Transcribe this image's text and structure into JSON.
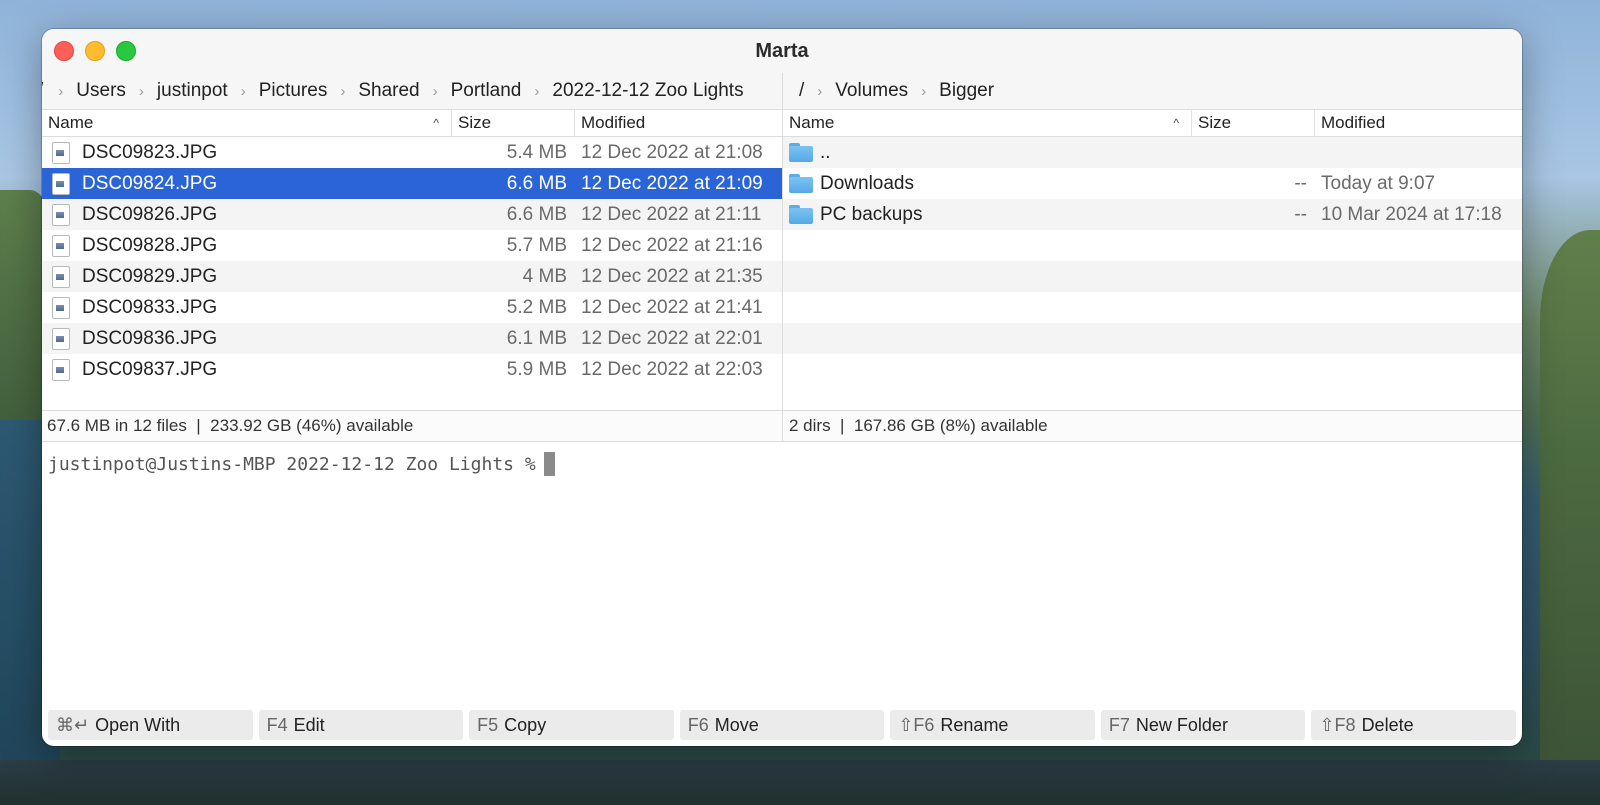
{
  "window": {
    "title": "Marta"
  },
  "left_pane": {
    "breadcrumb": [
      "/",
      "Users",
      "justinpot",
      "Pictures",
      "Shared",
      "Portland",
      "2022-12-12 Zoo Lights"
    ],
    "columns": {
      "name": "Name",
      "size": "Size",
      "modified": "Modified"
    },
    "sort_indicator": "^",
    "files": [
      {
        "name": "DSC09823.JPG",
        "size": "5.4 MB",
        "modified": "12 Dec 2022 at 21:08",
        "selected": false
      },
      {
        "name": "DSC09824.JPG",
        "size": "6.6 MB",
        "modified": "12 Dec 2022 at 21:09",
        "selected": true
      },
      {
        "name": "DSC09826.JPG",
        "size": "6.6 MB",
        "modified": "12 Dec 2022 at 21:11",
        "selected": false
      },
      {
        "name": "DSC09828.JPG",
        "size": "5.7 MB",
        "modified": "12 Dec 2022 at 21:16",
        "selected": false
      },
      {
        "name": "DSC09829.JPG",
        "size": "4 MB",
        "modified": "12 Dec 2022 at 21:35",
        "selected": false
      },
      {
        "name": "DSC09833.JPG",
        "size": "5.2 MB",
        "modified": "12 Dec 2022 at 21:41",
        "selected": false
      },
      {
        "name": "DSC09836.JPG",
        "size": "6.1 MB",
        "modified": "12 Dec 2022 at 22:01",
        "selected": false
      },
      {
        "name": "DSC09837.JPG",
        "size": "5.9 MB",
        "modified": "12 Dec 2022 at 22:03",
        "selected": false
      }
    ],
    "status": "67.6 MB in 12 files  |  233.92 GB (46%) available"
  },
  "right_pane": {
    "breadcrumb": [
      "/",
      "Volumes",
      "Bigger"
    ],
    "columns": {
      "name": "Name",
      "size": "Size",
      "modified": "Modified"
    },
    "sort_indicator": "^",
    "items": [
      {
        "name": "..",
        "size": "",
        "modified": ""
      },
      {
        "name": "Downloads",
        "size": "--",
        "modified": "Today at 9:07"
      },
      {
        "name": "PC backups",
        "size": "--",
        "modified": "10 Mar 2024 at 17:18"
      }
    ],
    "empty_rows": 4,
    "status": "2 dirs  |  167.86 GB (8%) available"
  },
  "terminal": {
    "prompt": "justinpot@Justins-MBP 2022-12-12 Zoo Lights %"
  },
  "function_keys": [
    {
      "key": "⌘↵",
      "label": "Open With"
    },
    {
      "key": "F4",
      "label": "Edit"
    },
    {
      "key": "F5",
      "label": "Copy"
    },
    {
      "key": "F6",
      "label": "Move"
    },
    {
      "key": "⇧F6",
      "label": "Rename"
    },
    {
      "key": "F7",
      "label": "New Folder"
    },
    {
      "key": "⇧F8",
      "label": "Delete"
    }
  ],
  "colors": {
    "selection": "#2a64d6",
    "close": "#fe5f57",
    "minimize": "#febc2e",
    "maximize": "#28c840",
    "folder": "#55a8e6"
  }
}
